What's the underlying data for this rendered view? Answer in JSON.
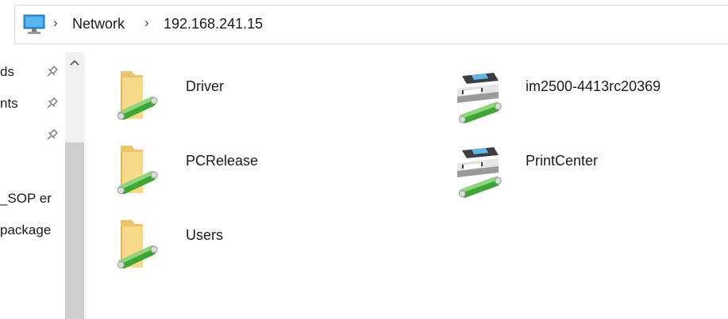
{
  "address": {
    "root_icon": "this-pc-icon",
    "crumbs": [
      "Network",
      "192.168.241.15"
    ]
  },
  "nav": {
    "items": [
      {
        "label": "ds",
        "pinned": true
      },
      {
        "label": "nts",
        "pinned": true
      },
      {
        "label": "",
        "pinned": true
      },
      {
        "label": "_SOP er",
        "pinned": false
      },
      {
        "label": "package",
        "pinned": false
      }
    ]
  },
  "content": {
    "items": [
      {
        "name": "Driver",
        "type": "shared-folder"
      },
      {
        "name": "PCRelease",
        "type": "shared-folder"
      },
      {
        "name": "Users",
        "type": "shared-folder"
      },
      {
        "name": "im2500-4413rc20369",
        "type": "network-printer"
      },
      {
        "name": "PrintCenter",
        "type": "network-printer"
      }
    ]
  }
}
